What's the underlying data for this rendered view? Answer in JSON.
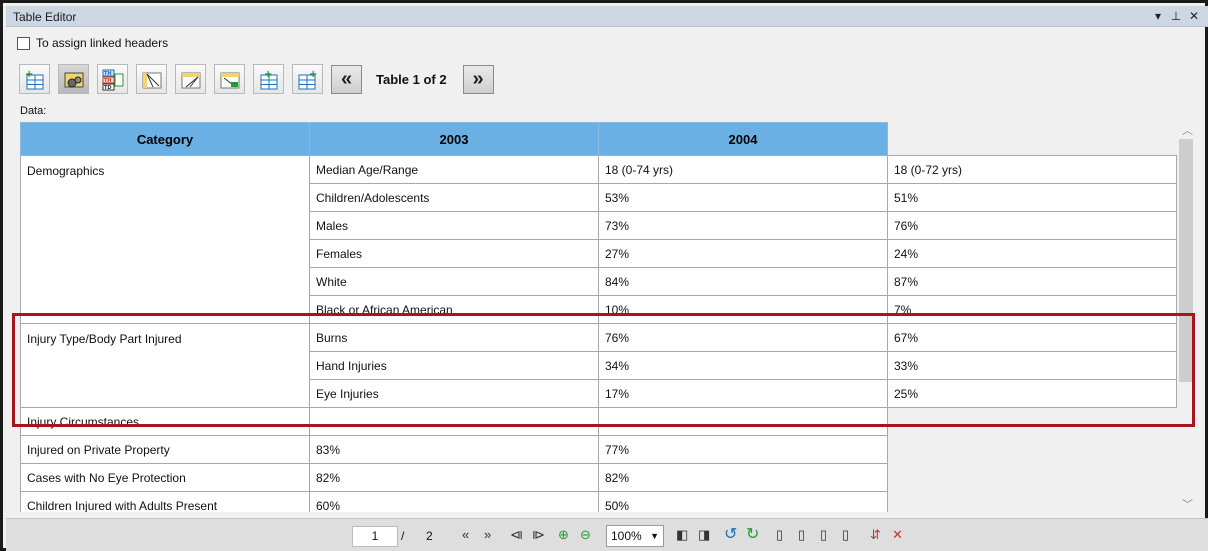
{
  "window": {
    "title": "Table Editor",
    "pin_icon": "pin-icon",
    "close_icon": "close-icon"
  },
  "options": {
    "linked_headers_label": "To assign linked headers"
  },
  "toolbar": {
    "table_counter": "Table 1 of 2",
    "prev_label": "«",
    "next_label": "»"
  },
  "data_label": "Data:",
  "table": {
    "headers": [
      "Category",
      "2003",
      "2004"
    ],
    "rows": [
      [
        "Demographics",
        "Median Age/Range",
        "18 (0-74 yrs)",
        "18 (0-72 yrs)"
      ],
      [
        "",
        "Children/Adolescents",
        "53%",
        "51%"
      ],
      [
        "",
        "Males",
        "73%",
        "76%"
      ],
      [
        "",
        "Females",
        "27%",
        "24%"
      ],
      [
        "",
        "White",
        "84%",
        "87%"
      ],
      [
        "",
        "Black or African American",
        "10%",
        "7%"
      ],
      [
        "Injury Type/Body Part Injured",
        "Burns",
        "76%",
        "67%"
      ],
      [
        "",
        "Hand Injuries",
        "34%",
        "33%"
      ],
      [
        "",
        "Eye Injuries",
        "17%",
        "25%"
      ],
      [
        "Injury Circumstances",
        "",
        ""
      ],
      [
        "Injured on Private Property",
        "83%",
        "77%"
      ],
      [
        "Cases with No Eye Protection",
        "82%",
        "82%"
      ],
      [
        "Children Injured with Adults Present",
        "60%",
        "50%"
      ]
    ]
  },
  "statusbar": {
    "page_value": "1",
    "page_sep": "/",
    "page_total": "2",
    "zoom_value": "100%"
  },
  "colors": {
    "header_bg": "#6ab0e4",
    "highlight": "#a7161c",
    "titlebar": "#cdd7e4"
  }
}
